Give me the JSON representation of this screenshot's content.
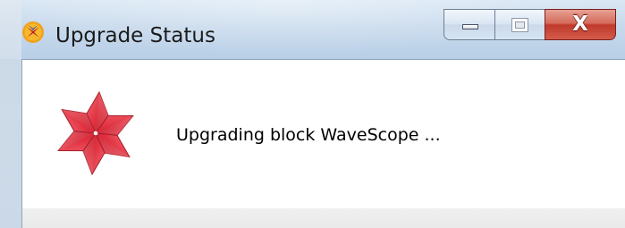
{
  "window": {
    "title": "Upgrade Status",
    "icon": "app-title-icon",
    "buttons": {
      "minimize": "minimize-button",
      "maximize": "maximize-button",
      "close": "close-button",
      "close_glyph": "X"
    }
  },
  "content": {
    "logo_icon": "red-pinwheel-logo",
    "message": "Upgrading block WaveScope ..."
  },
  "colors": {
    "close_button": "#c0392b",
    "logo_red": "#e33a45",
    "client_background": "#ffffff"
  }
}
